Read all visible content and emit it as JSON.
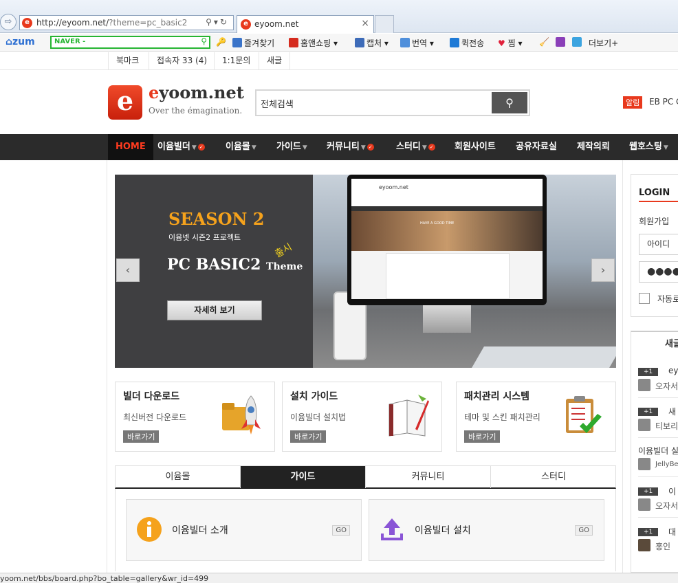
{
  "browser": {
    "url_main": "http://eyoom.net/",
    "url_query": "?theme=pc_basic2",
    "tab_title": "eyoom.net",
    "logo_letter": "e"
  },
  "toolbar": {
    "zum": "zum",
    "naver": "NAVER -",
    "items": [
      "즐겨찾기",
      "홈앤쇼핑",
      "캡처",
      "번역",
      "퀵전송",
      "찜",
      "더보기+"
    ]
  },
  "topbar": {
    "links": [
      "북마크",
      "접속자 33 (4)",
      "1:1문의",
      "새글"
    ]
  },
  "header": {
    "logo_letter": "e",
    "site_name_e": "e",
    "site_name_rest": "yoom.net",
    "tagline": "Over the émagination.",
    "search_value": "전체검색",
    "search_icon": "search-icon",
    "alarm_badge": "알림",
    "alarm_text": "EB PC C"
  },
  "nav": {
    "home": "HOME",
    "items": [
      "이윰빌더",
      "이윰몰",
      "가이드",
      "커뮤니티",
      "스터디",
      "회원사이트",
      "공유자료실",
      "제작의뢰",
      "웹호스팅"
    ]
  },
  "slider": {
    "season": "SEASON 2",
    "subtitle": "이윰넷 시즌2 프로젝트",
    "title": "PC BASIC2",
    "theme_word": "Theme",
    "new_badge": "출시",
    "button": "자세히 보기",
    "prev": "‹",
    "next": "›",
    "screen_logo": "eyoom.net",
    "screen_hero": "HAVE A GOOD TIME"
  },
  "features": [
    {
      "title": "빌더 다운로드",
      "desc": "최신버전 다운로드",
      "link": "바로가기",
      "icon": "folder-rocket-icon"
    },
    {
      "title": "설치 가이드",
      "desc": "이윰빌더 설치법",
      "link": "바로가기",
      "icon": "book-pen-icon"
    },
    {
      "title": "패치관리 시스템",
      "desc": "테마 및 스킨 패치관리",
      "link": "바로가기",
      "icon": "clipboard-check-icon"
    }
  ],
  "tabs": [
    "이윰몰",
    "가이드",
    "커뮤니티",
    "스터디"
  ],
  "active_tab": 1,
  "guides": [
    {
      "title": "이윰빌더 소개",
      "go": "GO",
      "icon": "info-icon"
    },
    {
      "title": "이윰빌더 설치",
      "go": "GO",
      "icon": "upload-icon"
    }
  ],
  "sidebar": {
    "login_title": "LOGIN",
    "join": "회원가입",
    "id_value": "아이디",
    "pw_value": "●●●●",
    "auto_label": "자동로",
    "new_title": "새글",
    "new_items": [
      {
        "badge": "+1",
        "title": "eyo",
        "author": "오자서"
      },
      {
        "badge": "+1",
        "title": "새",
        "author": "티보리"
      },
      {
        "badge": "",
        "title": "이윰빌더 실",
        "author": "JellyBe"
      },
      {
        "badge": "+1",
        "title": "이",
        "author": "오자서"
      },
      {
        "badge": "+1",
        "title": "대",
        "author": "홍인"
      }
    ]
  },
  "status": {
    "text": "yoom.net/bbs/board.php?bo_table=gallery&wr_id=499"
  },
  "colors": {
    "brand": "#e8391d",
    "nav_bg": "#2b2b2b",
    "accent_orange": "#f5a21c",
    "naver_green": "#26b532"
  }
}
